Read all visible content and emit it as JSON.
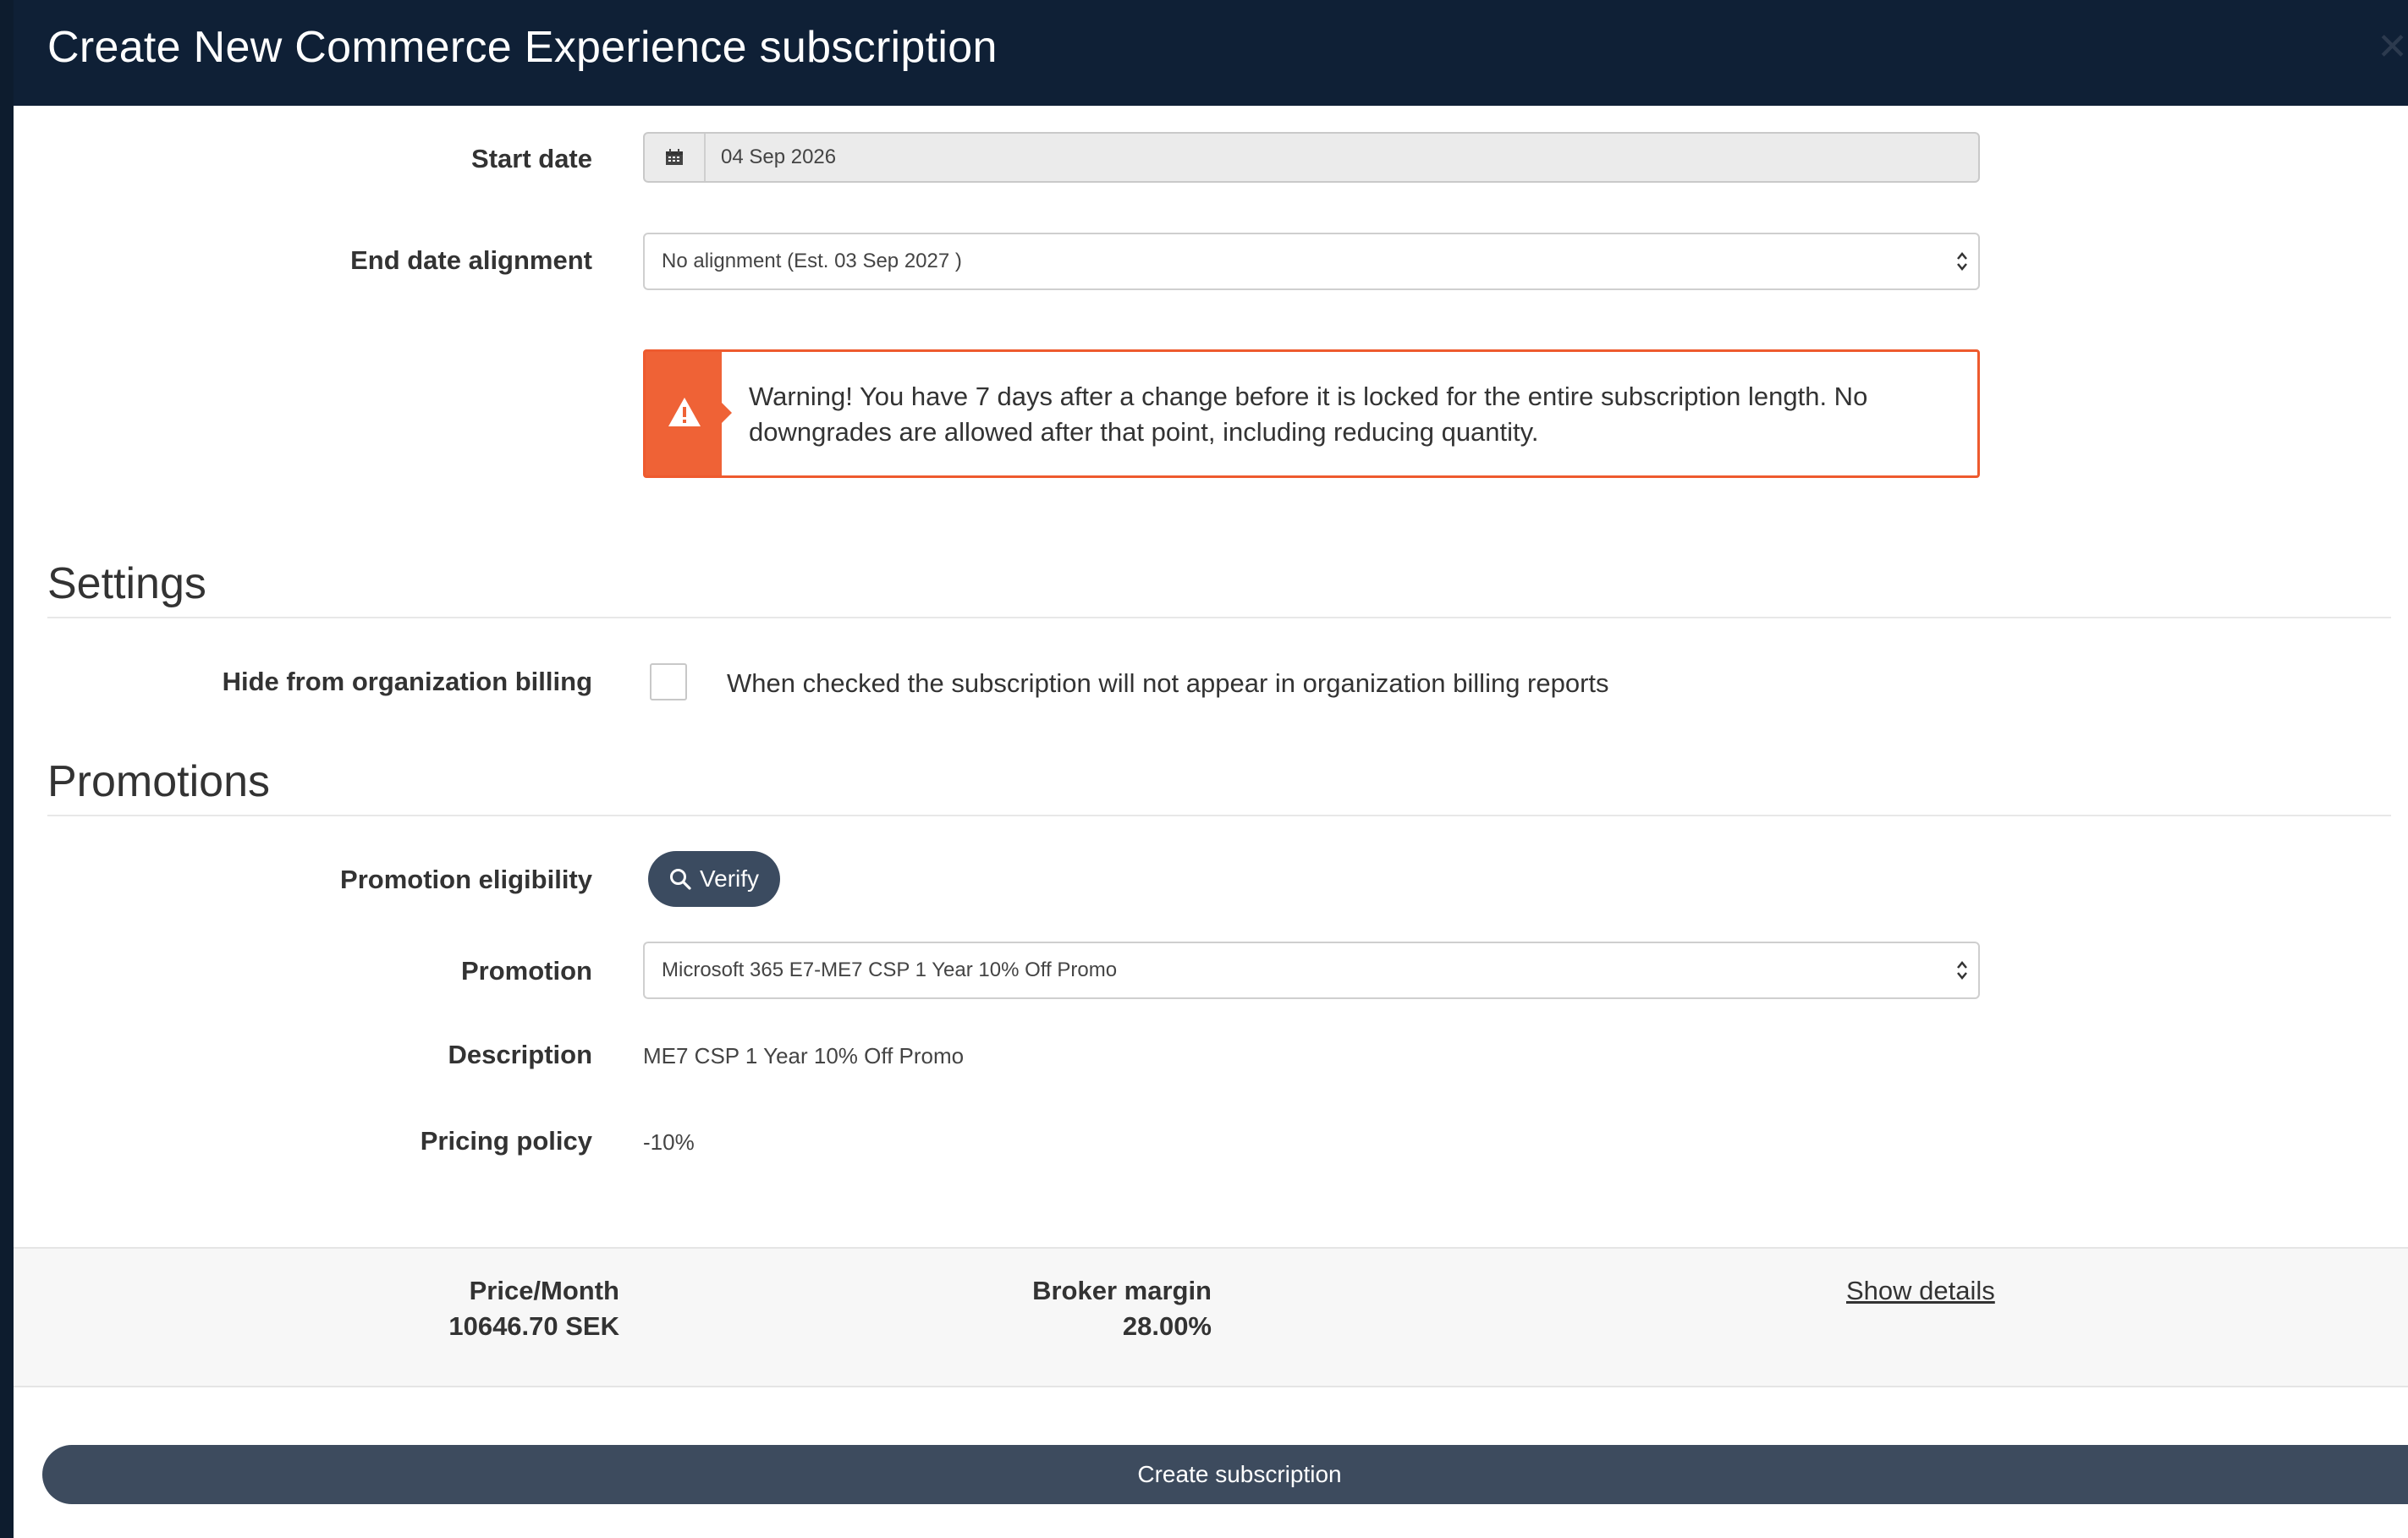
{
  "modal": {
    "title": "Create New Commerce Experience subscription",
    "close_icon": "close-icon"
  },
  "form": {
    "start_date": {
      "label": "Start date",
      "value": "04 Sep 2026",
      "icon": "calendar-icon"
    },
    "end_date_alignment": {
      "label": "End date alignment",
      "value": "No alignment (Est. 03 Sep 2027 )"
    },
    "warning": {
      "icon": "warning-icon",
      "text": "Warning! You have 7 days after a change before it is locked for the entire subscription length. No downgrades are allowed after that point, including reducing quantity."
    }
  },
  "settings": {
    "title": "Settings",
    "hide_billing": {
      "label": "Hide from organization billing",
      "checked": false,
      "description": "When checked the subscription will not appear in organization billing reports"
    }
  },
  "promotions": {
    "title": "Promotions",
    "eligibility": {
      "label": "Promotion eligibility",
      "button": "Verify",
      "icon": "search-icon"
    },
    "promotion": {
      "label": "Promotion",
      "value": "Microsoft 365 E7-ME7 CSP 1 Year 10% Off Promo"
    },
    "description": {
      "label": "Description",
      "value": "ME7 CSP 1 Year 10% Off Promo"
    },
    "pricing_policy": {
      "label": "Pricing policy",
      "value": "-10%"
    }
  },
  "footer": {
    "price_label": "Price/Month",
    "price_value": "10646.70 SEK",
    "margin_label": "Broker margin",
    "margin_value": "28.00%",
    "show_details": "Show details"
  },
  "actions": {
    "create": "Create subscription"
  },
  "colors": {
    "header": "#0f2036",
    "warning": "#ef6236",
    "button": "#3d4b5e"
  }
}
